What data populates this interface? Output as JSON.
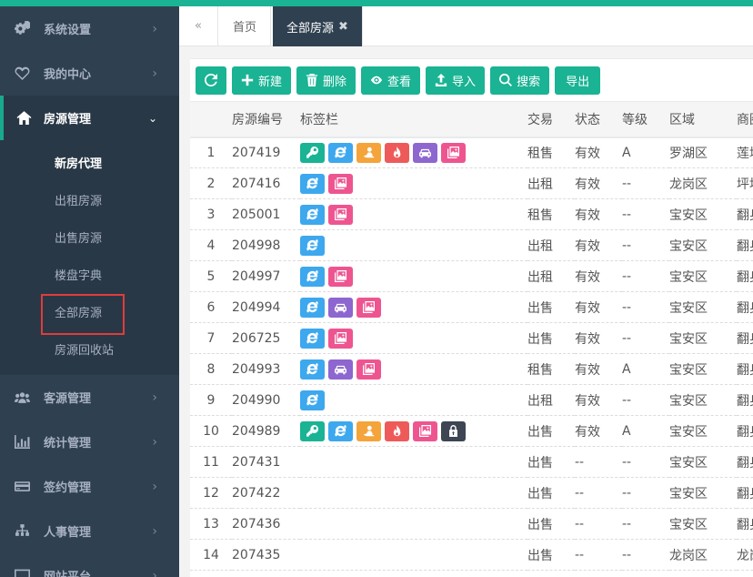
{
  "sidebar": {
    "items": [
      {
        "label": "系统设置",
        "icon": "gears-icon"
      },
      {
        "label": "我的中心",
        "icon": "heart-icon"
      },
      {
        "label": "房源管理",
        "icon": "home-icon",
        "expanded": true
      },
      {
        "label": "客源管理",
        "icon": "users-icon"
      },
      {
        "label": "统计管理",
        "icon": "bar-chart-icon"
      },
      {
        "label": "签约管理",
        "icon": "credit-card-icon"
      },
      {
        "label": "人事管理",
        "icon": "sitemap-icon"
      },
      {
        "label": "网站平台",
        "icon": "desktop-icon"
      }
    ],
    "submenu": [
      "新房代理",
      "出租房源",
      "出售房源",
      "楼盘字典",
      "全部房源",
      "房源回收站"
    ],
    "arrow_collapsed": "›",
    "arrow_expanded": "⌄"
  },
  "tabs": {
    "back_icon": "«",
    "home": "首页",
    "active": "全部房源",
    "close": "✖"
  },
  "toolbar": {
    "refresh_icon": "refresh-icon",
    "new": "新建",
    "delete": "删除",
    "view": "查看",
    "import": "导入",
    "search": "搜索",
    "export": "导出"
  },
  "table": {
    "headers": [
      "",
      "房源编号",
      "标签栏",
      "交易",
      "状态",
      "等级",
      "区域",
      "商圈"
    ],
    "rows": [
      {
        "idx": "1",
        "id": "207419",
        "tags": [
          "key",
          "ie",
          "person",
          "fire",
          "car",
          "img"
        ],
        "deal": "租售",
        "status": "有效",
        "level": "A",
        "area": "罗湖区",
        "zone": "莲塘"
      },
      {
        "idx": "2",
        "id": "207416",
        "tags": [
          "ie",
          "img"
        ],
        "deal": "出租",
        "status": "有效",
        "level": "--",
        "area": "龙岗区",
        "zone": "坪地"
      },
      {
        "idx": "3",
        "id": "205001",
        "tags": [
          "ie",
          "img"
        ],
        "deal": "租售",
        "status": "有效",
        "level": "--",
        "area": "宝安区",
        "zone": "翻身"
      },
      {
        "idx": "4",
        "id": "204998",
        "tags": [
          "ie"
        ],
        "deal": "出租",
        "status": "有效",
        "level": "--",
        "area": "宝安区",
        "zone": "翻身"
      },
      {
        "idx": "5",
        "id": "204997",
        "tags": [
          "ie",
          "img"
        ],
        "deal": "出租",
        "status": "有效",
        "level": "--",
        "area": "宝安区",
        "zone": "翻身"
      },
      {
        "idx": "6",
        "id": "204994",
        "tags": [
          "ie",
          "car",
          "img"
        ],
        "deal": "出售",
        "status": "有效",
        "level": "--",
        "area": "宝安区",
        "zone": "翻身"
      },
      {
        "idx": "7",
        "id": "206725",
        "tags": [
          "ie",
          "img"
        ],
        "deal": "出售",
        "status": "有效",
        "level": "--",
        "area": "宝安区",
        "zone": "翻身"
      },
      {
        "idx": "8",
        "id": "204993",
        "tags": [
          "ie",
          "car",
          "img"
        ],
        "deal": "租售",
        "status": "有效",
        "level": "A",
        "area": "宝安区",
        "zone": "翻身"
      },
      {
        "idx": "9",
        "id": "204990",
        "tags": [
          "ie"
        ],
        "deal": "出租",
        "status": "有效",
        "level": "--",
        "area": "宝安区",
        "zone": "翻身"
      },
      {
        "idx": "10",
        "id": "204989",
        "tags": [
          "key",
          "ie",
          "person",
          "fire",
          "img",
          "lock"
        ],
        "deal": "出售",
        "status": "有效",
        "level": "A",
        "area": "宝安区",
        "zone": "翻身"
      },
      {
        "idx": "11",
        "id": "207431",
        "tags": [],
        "deal": "出售",
        "status": "--",
        "level": "--",
        "area": "宝安区",
        "zone": "翻身"
      },
      {
        "idx": "12",
        "id": "207422",
        "tags": [],
        "deal": "出售",
        "status": "--",
        "level": "--",
        "area": "宝安区",
        "zone": "翻身"
      },
      {
        "idx": "13",
        "id": "207436",
        "tags": [],
        "deal": "出售",
        "status": "--",
        "level": "--",
        "area": "宝安区",
        "zone": "翻身"
      },
      {
        "idx": "14",
        "id": "207435",
        "tags": [],
        "deal": "出售",
        "status": "--",
        "level": "--",
        "area": "龙岗区",
        "zone": "龙岗"
      }
    ]
  },
  "colors": {
    "accent": "#1ab394",
    "sidebar_bg": "#2f4050",
    "highlight_box": "#e03c3c"
  }
}
